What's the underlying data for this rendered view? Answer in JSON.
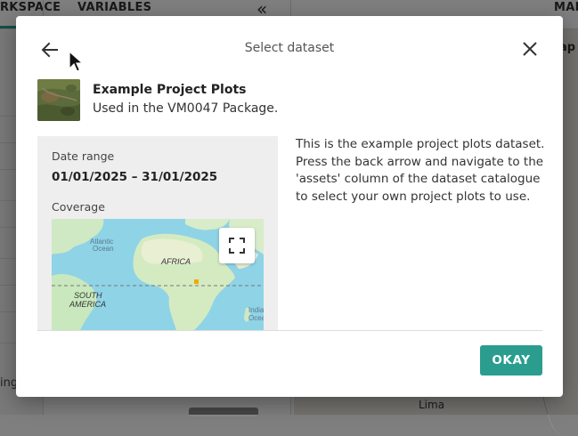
{
  "background": {
    "tabs": [
      "RKSPACE",
      "VARIABLES"
    ],
    "collapse_icon": "«",
    "right_tab": "MAR",
    "left_truncated": "ing",
    "map_caption": "ap",
    "map_city": "Lima"
  },
  "modal": {
    "title": "Select dataset",
    "back_icon": "arrow-left-icon",
    "close_icon": "close-icon",
    "dataset": {
      "name": "Example Project Plots",
      "subtitle": "Used in the VM0047 Package."
    },
    "info": {
      "date_label": "Date range",
      "date_value": "01/01/2025 – 31/01/2025",
      "coverage_label": "Coverage",
      "map_labels": {
        "atlantic": "Atlantic",
        "ocean": "Ocean",
        "africa": "AFRICA",
        "south": "SOUTH",
        "america": "AMERICA",
        "india": "India",
        "india_ocean": "Ocea"
      }
    },
    "description": "This is the example project plots dataset. Press the back arrow and navigate to the 'assets' column of the dataset catalogue to select your own project plots to use.",
    "okay_label": "OKAY"
  },
  "colors": {
    "accent": "#2a9d8f",
    "overlay": "rgba(0,0,0,0.5)",
    "ocean": "#8fd3e6",
    "land": "#cfe9c5"
  }
}
